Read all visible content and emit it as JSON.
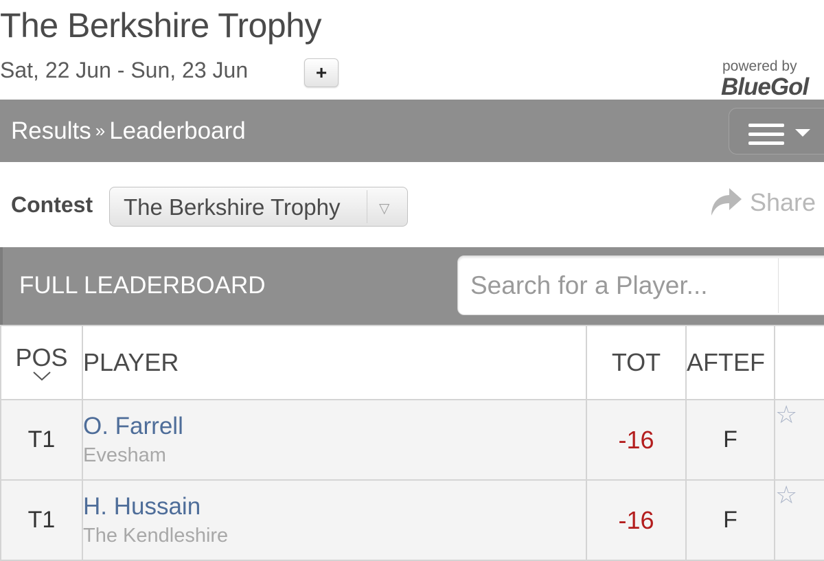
{
  "event": {
    "title": "The Berkshire Trophy",
    "dates": "Sat, 22 Jun - Sun, 23 Jun",
    "add_button": "+"
  },
  "branding": {
    "powered_by": "powered by",
    "brand": "BlueGol"
  },
  "navbar": {
    "crumb_results": "Results",
    "crumb_separator": "»",
    "crumb_current": "Leaderboard",
    "menu_icon": "hamburger-menu-icon"
  },
  "contest": {
    "label": "Contest",
    "selected": "The Berkshire Trophy",
    "dropdown_arrow": "▽"
  },
  "share": {
    "label": "Share",
    "icon": "share-arrow-icon"
  },
  "leaderboard": {
    "title": "FULL LEADERBOARD",
    "search_placeholder": "Search for a Player...",
    "columns": {
      "pos": "POS",
      "pos_sort": "⌄",
      "player": "PLAYER",
      "tot": "TOT",
      "after": "AFTEF"
    },
    "rows": [
      {
        "pos": "T1",
        "player": "O. Farrell",
        "club": "Evesham",
        "tot": "-16",
        "after": "F",
        "fav": "☆"
      },
      {
        "pos": "T1",
        "player": "H. Hussain",
        "club": "The Kendleshire",
        "tot": "-16",
        "after": "F",
        "fav": "☆"
      }
    ]
  },
  "colors": {
    "navbar_bg": "#8e8e8e",
    "player_link": "#4e6d99",
    "score_under_par": "#b31d1d"
  }
}
